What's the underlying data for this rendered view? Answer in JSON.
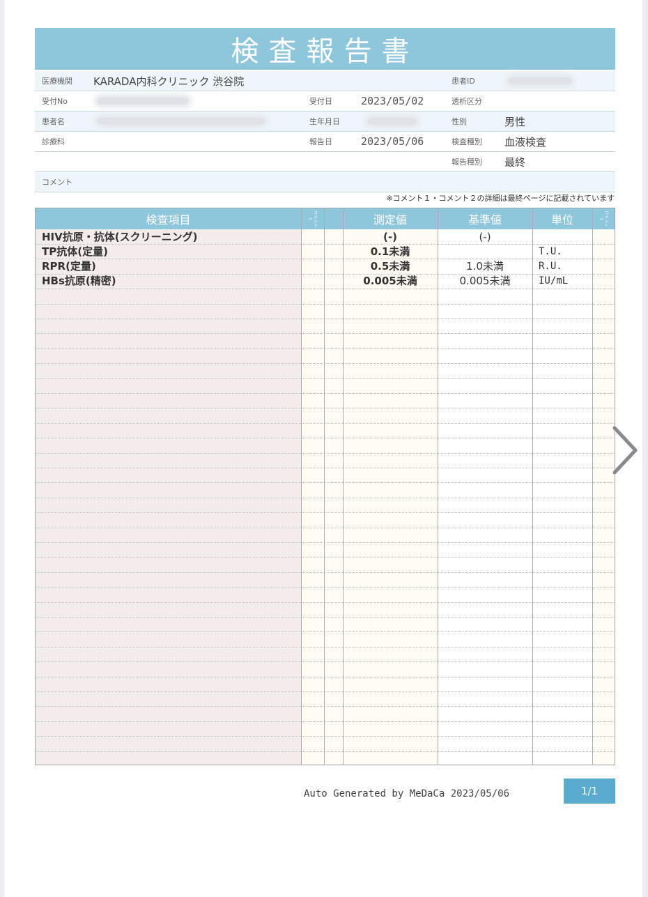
{
  "report": {
    "title": "検査報告書",
    "labels": {
      "institution": "医療機関",
      "reception_no": "受付No",
      "patient_name": "患者名",
      "department": "診療科",
      "reception_date": "受付日",
      "birth_date": "生年月日",
      "report_date": "報告日",
      "patient_id": "患者ID",
      "dialysis": "透析区分",
      "sex": "性別",
      "exam_type": "検査種別",
      "report_type": "報告種別",
      "comment": "コメント"
    },
    "values": {
      "institution": "KARADA内科クリニック 渋谷院",
      "reception_date": "2023/05/02",
      "report_date": "2023/05/06",
      "sex": "男性",
      "exam_type": "血液検査",
      "report_type": "最終"
    },
    "note": "※コメント１・コメント２の詳細は最終ページに記載されています"
  },
  "table": {
    "headers": {
      "item": "検査項目",
      "comment1": "コメント1",
      "measured": "測定値",
      "reference": "基準値",
      "unit": "単位",
      "comment2": "コメント2"
    },
    "rows": [
      {
        "item": "HIV抗原・抗体(スクリーニング)",
        "measured": "(-)",
        "reference": "(-)",
        "unit": ""
      },
      {
        "item": "TP抗体(定量)",
        "measured": "0.1未満",
        "reference": "",
        "unit": "T.U."
      },
      {
        "item": "RPR(定量)",
        "measured": "0.5未満",
        "reference": "1.0未満",
        "unit": "R.U."
      },
      {
        "item": "HBs抗原(精密)",
        "measured": "0.005未満",
        "reference": "0.005未満",
        "unit": "IU/mL"
      }
    ]
  },
  "footer": {
    "generated": "Auto Generated by MeDaCa 2023/05/06",
    "page": "1/1"
  },
  "nav": {
    "next_icon": "chevron-right-icon"
  }
}
